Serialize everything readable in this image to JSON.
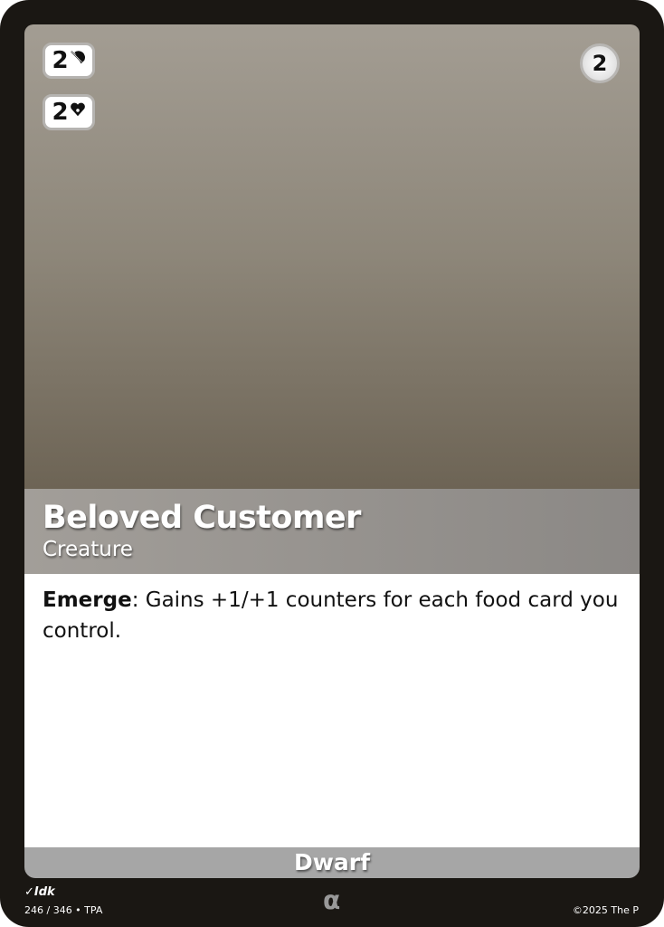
{
  "card": {
    "name": "Beloved Customer",
    "type_line": "Creature",
    "cost": "2",
    "attack": {
      "value": "2",
      "icon": "sword-shield-icon"
    },
    "health": {
      "value": "2",
      "icon": "heart-icon"
    },
    "rules_keyword": "Emerge",
    "rules_text": ": Gains +1/+1 counters for each food card you control.",
    "subtype": "Dwarf",
    "artist": "Idk",
    "collector_info": "246 / 346 • TPA",
    "rarity_symbol": "α",
    "copyright": "©2025 The P"
  }
}
